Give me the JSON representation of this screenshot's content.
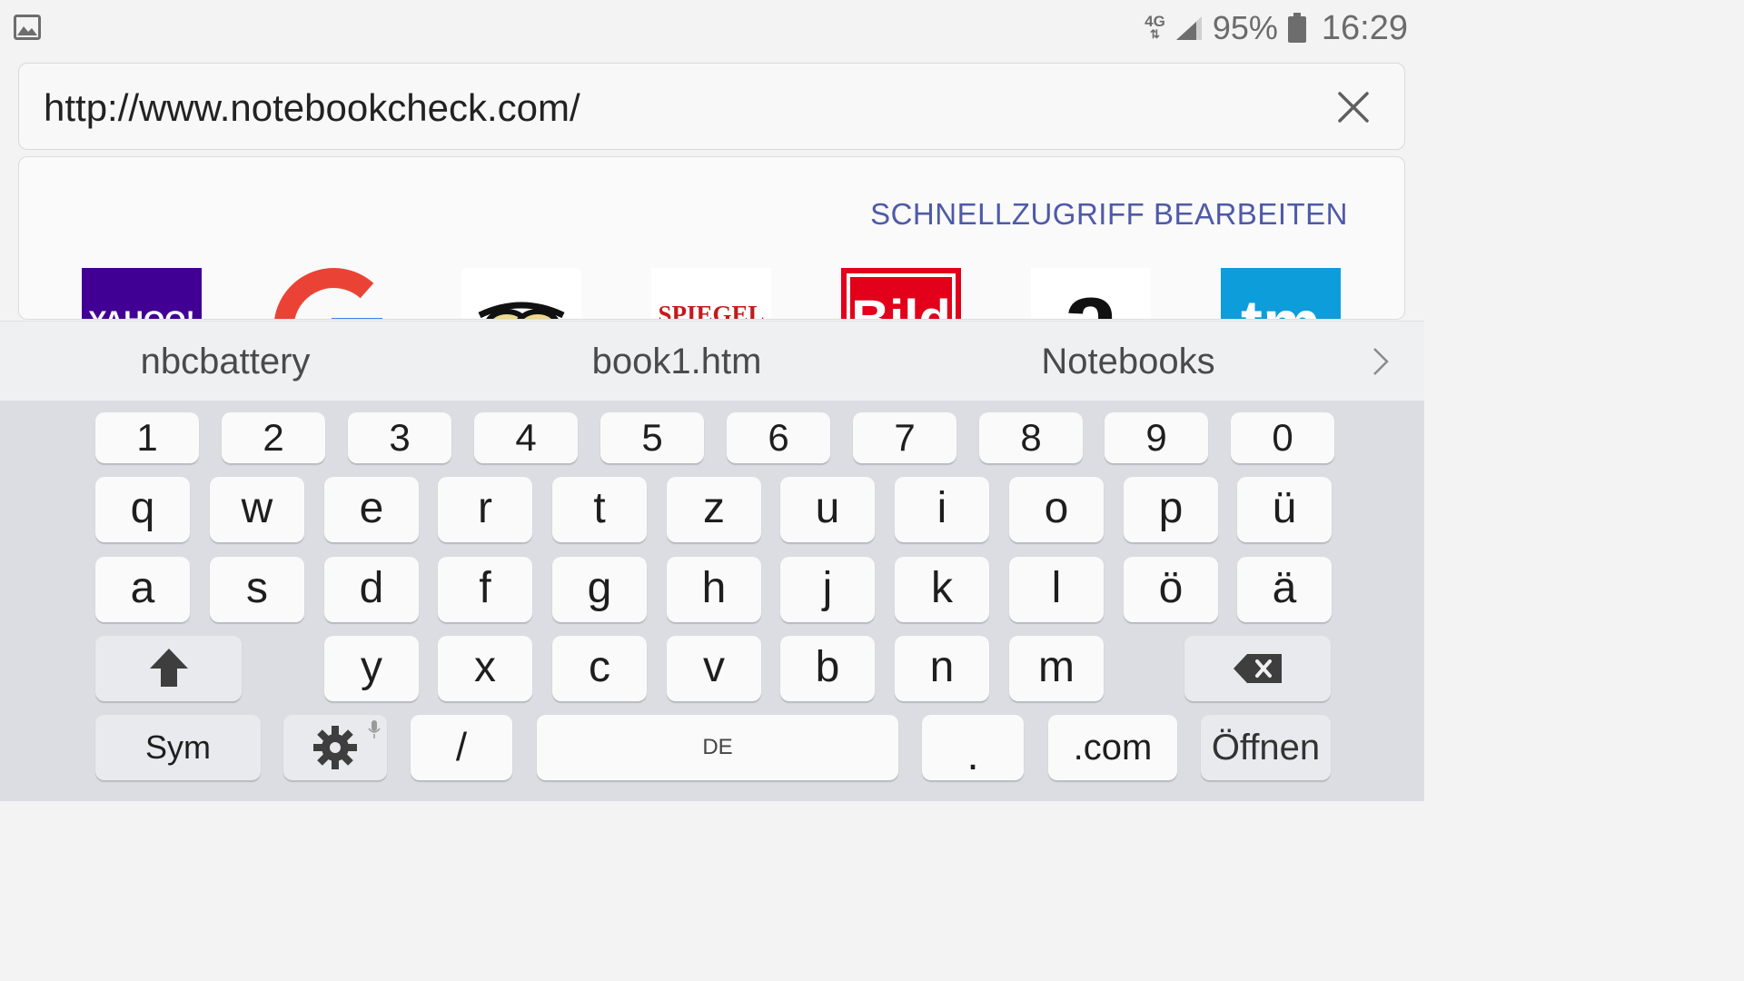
{
  "status_bar": {
    "network": "4G",
    "battery_percent": "95%",
    "time": "16:29",
    "icons": [
      "image-notification-icon",
      "signal-icon",
      "battery-icon"
    ]
  },
  "url_bar": {
    "value": "http://www.notebookcheck.com/"
  },
  "quick_access": {
    "edit_label": "SCHNELLZUGRIFF BEARBEITEN",
    "tiles": [
      "yahoo-tile",
      "google-tile",
      "tripadvisor-tile",
      "spiegel-tile",
      "bild-tile",
      "amazon-tile",
      "tm-tile"
    ],
    "tile_text": {
      "spiegel": "SPIEGEL",
      "bild": "Bild",
      "amazon": "a",
      "tm": "tm"
    }
  },
  "suggestions": [
    "nbcbattery",
    "book1.htm",
    "Notebooks"
  ],
  "keyboard": {
    "numbers": [
      "1",
      "2",
      "3",
      "4",
      "5",
      "6",
      "7",
      "8",
      "9",
      "0"
    ],
    "row1": [
      "q",
      "w",
      "e",
      "r",
      "t",
      "z",
      "u",
      "i",
      "o",
      "p",
      "ü"
    ],
    "row2": [
      "a",
      "s",
      "d",
      "f",
      "g",
      "h",
      "j",
      "k",
      "l",
      "ö",
      "ä"
    ],
    "row3": [
      "y",
      "x",
      "c",
      "v",
      "b",
      "n",
      "m"
    ],
    "sym_label": "Sym",
    "slash_label": "/",
    "space_label": "DE",
    "period_label": ".",
    "dotcom_label": ".com",
    "open_label": "Öffnen"
  }
}
